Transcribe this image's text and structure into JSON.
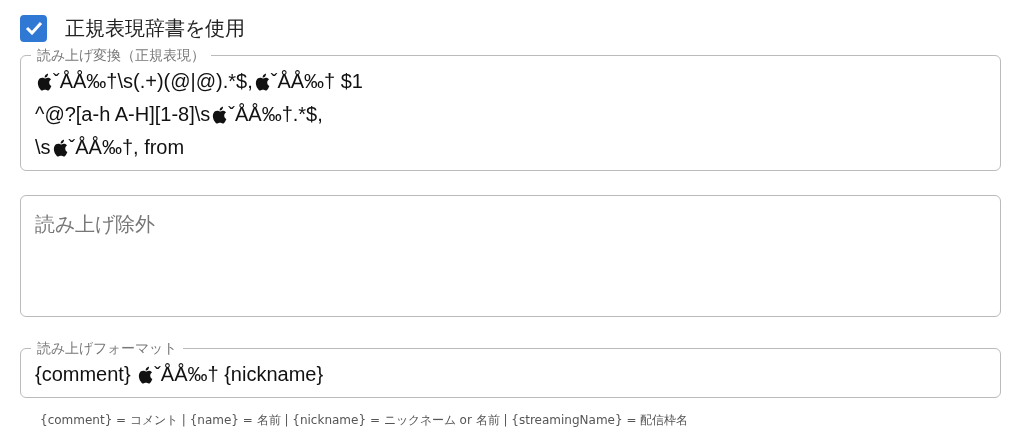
{
  "checkbox": {
    "label": "正規表現辞書を使用",
    "checked": true
  },
  "fields": [
    {
      "kind": "textarea",
      "label": "読み上げ変換（正規表現）",
      "lines": [
        [
          {
            "kind": "icon"
          },
          {
            "kind": "text",
            "text": "ˇÅÅ‰†\\s(.+)(@|@).*$,"
          },
          {
            "kind": "icon"
          },
          {
            "kind": "text",
            "text": "ˇÅÅ‰† $1"
          }
        ],
        [
          {
            "kind": "text",
            "text": "^@?[a-h A-H][1-8]\\s"
          },
          {
            "kind": "icon"
          },
          {
            "kind": "text",
            "text": "ˇÅÅ‰†.*$,"
          }
        ],
        [
          {
            "kind": "text",
            "text": "\\s"
          },
          {
            "kind": "icon"
          },
          {
            "kind": "text",
            "text": "ˇÅÅ‰†, from"
          }
        ]
      ]
    },
    {
      "kind": "textarea",
      "placeholder": "読み上げ除外"
    },
    {
      "kind": "input",
      "label": "読み上げフォーマット",
      "lines": [
        [
          {
            "kind": "text",
            "text": "{comment} "
          },
          {
            "kind": "icon"
          },
          {
            "kind": "text",
            "text": "ˇÅÅ‰† {nickname}"
          }
        ]
      ]
    }
  ],
  "helper_text": "{comment} = コメント | {name} = 名前 | {nickname} = ニックネーム or 名前 | {streamingName} = 配信枠名"
}
